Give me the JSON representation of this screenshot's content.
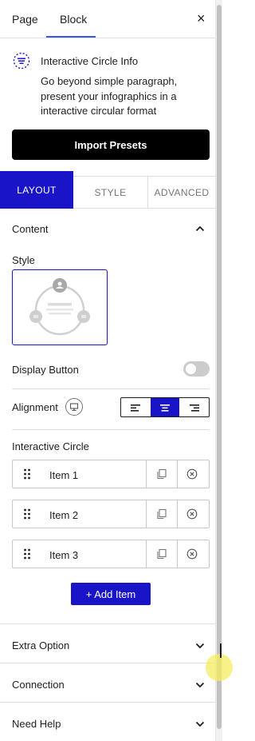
{
  "header": {
    "tab_page": "Page",
    "tab_block": "Block",
    "close_icon": "×"
  },
  "block_info": {
    "icon": "interactive-circle-icon",
    "title": "Interactive Circle Info",
    "description": "Go beyond simple paragraph, present your infographics in a interactive circular format"
  },
  "import_button": "Import Presets",
  "panel_tabs": {
    "layout": "LAYOUT",
    "style": "STYLE",
    "advanced": "ADVANCED"
  },
  "content_section": {
    "title": "Content",
    "style_label": "Style",
    "display_button_label": "Display Button",
    "display_button_on": false,
    "alignment_label": "Alignment",
    "alignment_selected": "center",
    "interactive_circle_label": "Interactive Circle",
    "items": [
      {
        "label": "Item 1"
      },
      {
        "label": "Item 2"
      },
      {
        "label": "Item 3"
      }
    ],
    "add_item": "+ Add Item"
  },
  "accordions": [
    {
      "label": "Extra Option"
    },
    {
      "label": "Connection"
    },
    {
      "label": "Need Help"
    }
  ],
  "colors": {
    "accent": "#1a14c8",
    "wp_blue": "#3858e9",
    "text": "#1e1e1e",
    "cursor_highlight": "#f6ec5f"
  }
}
